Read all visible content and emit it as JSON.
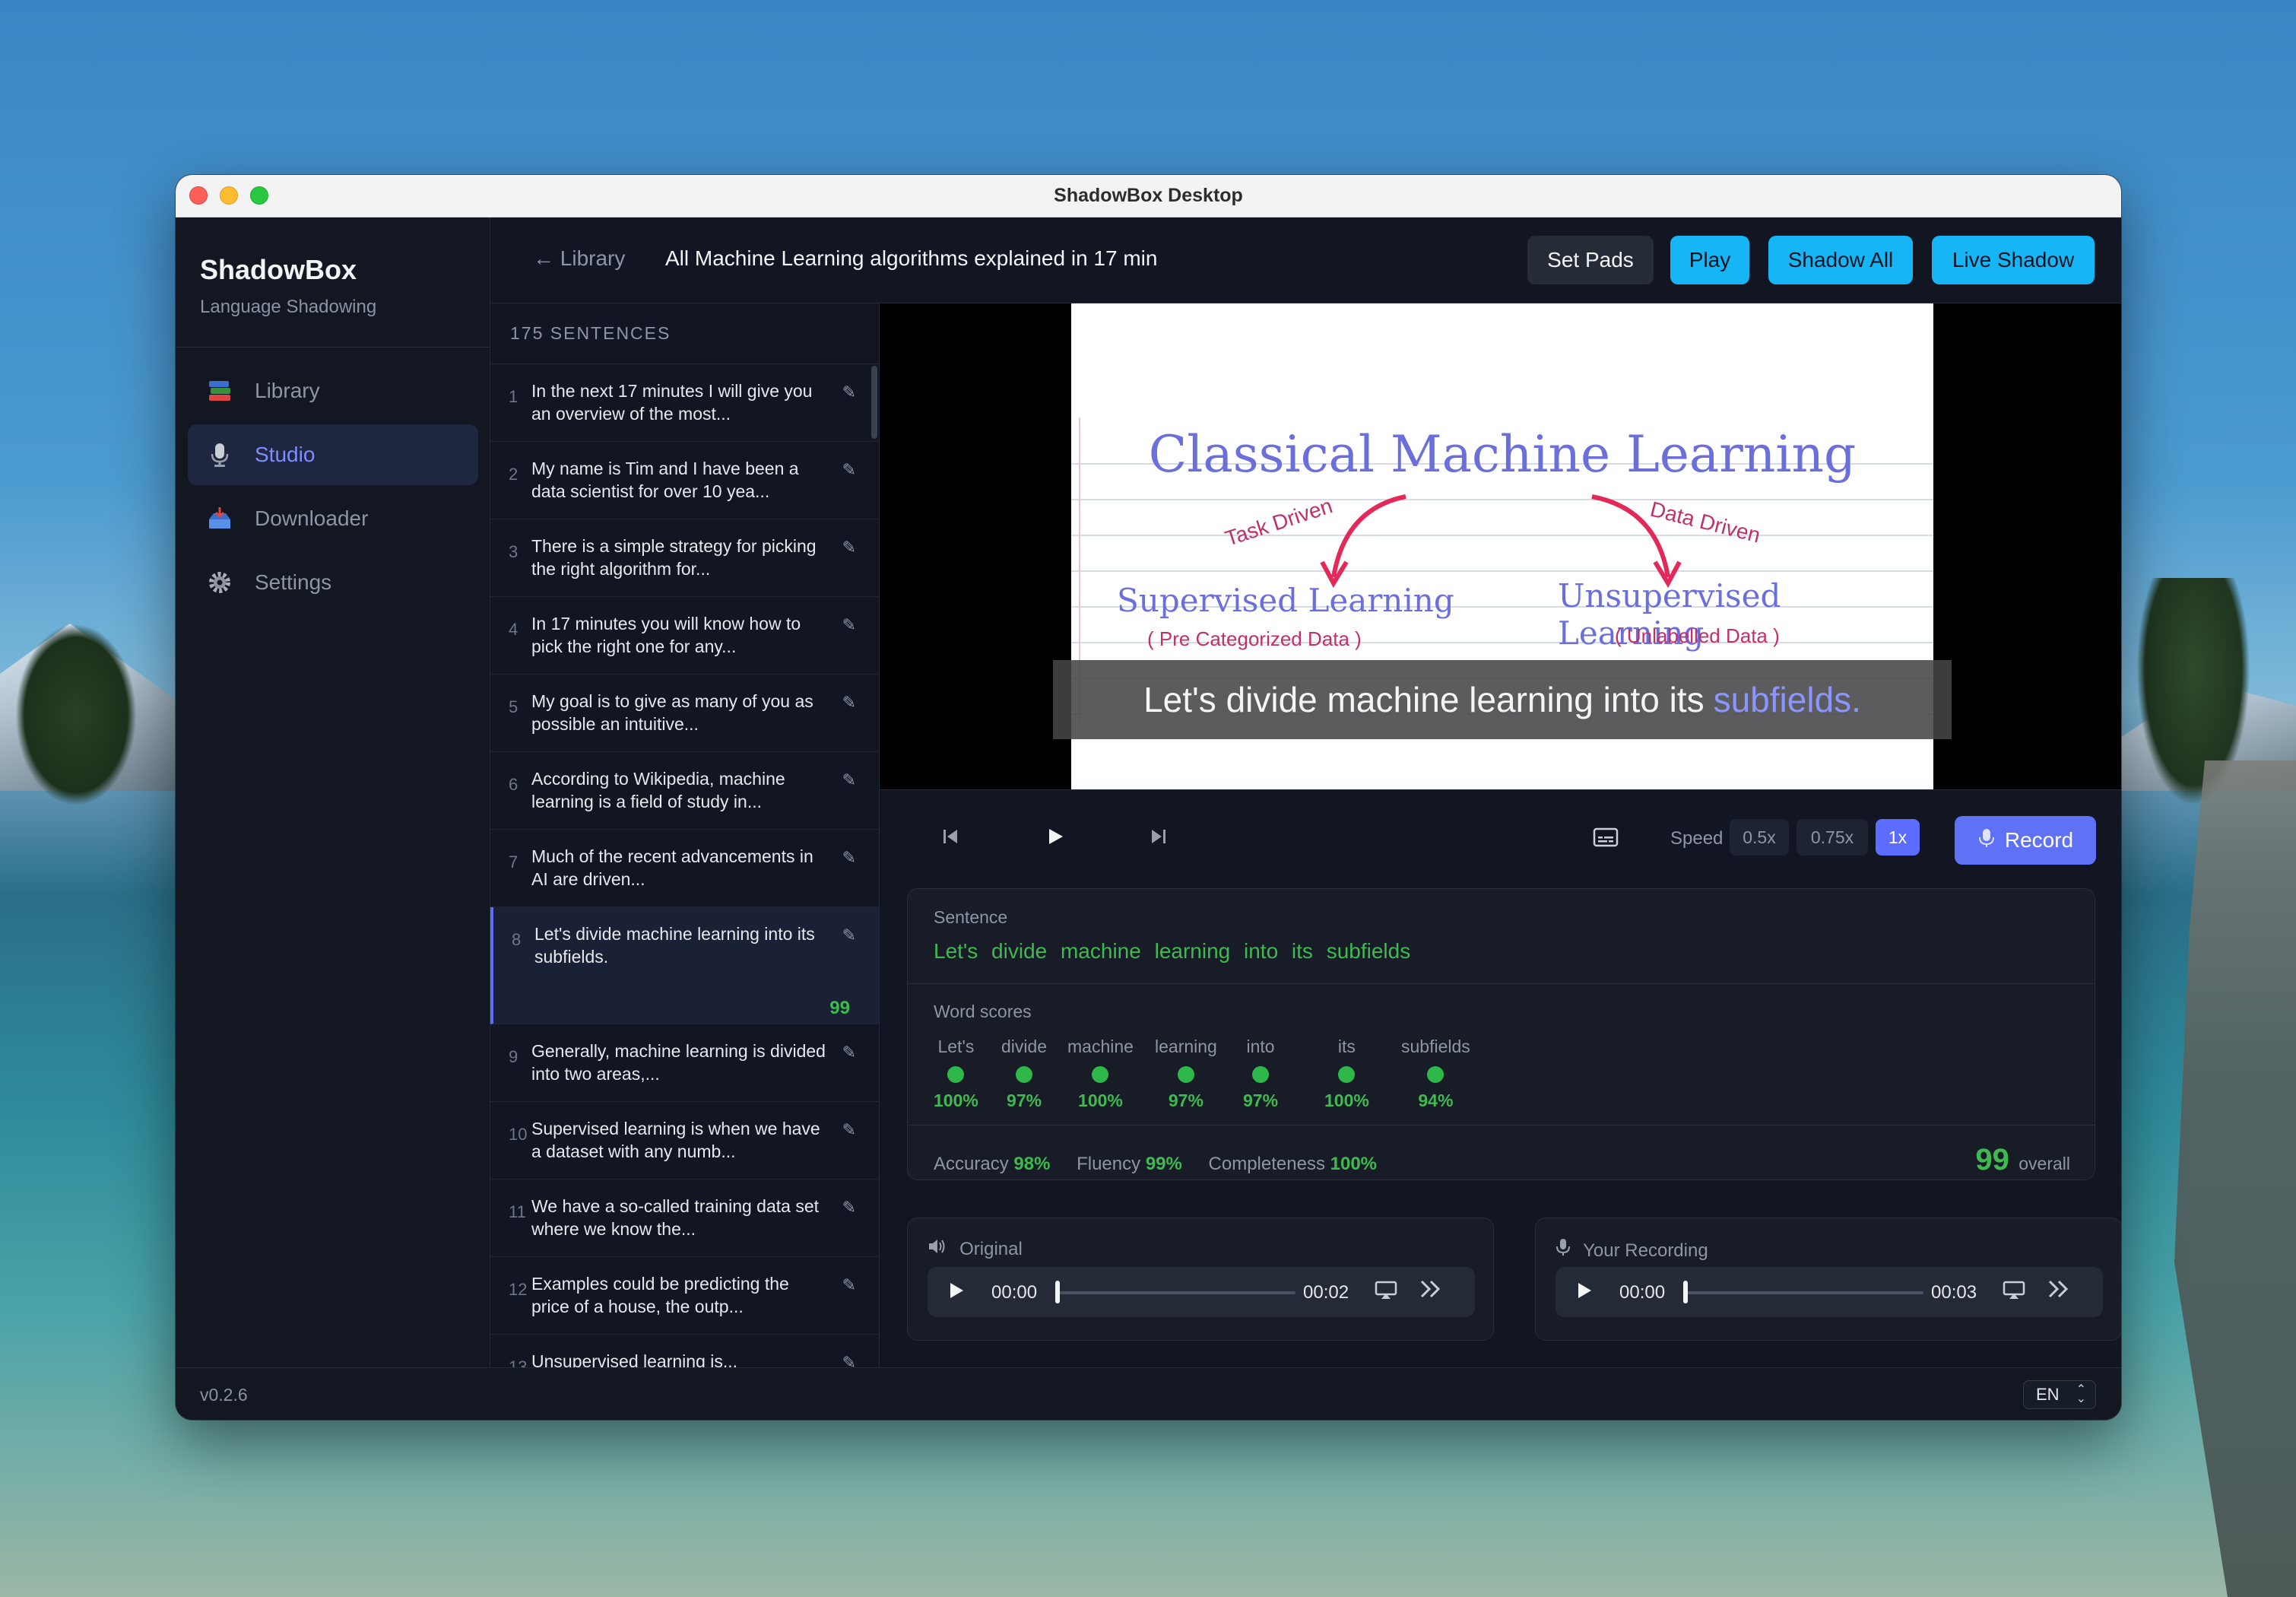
{
  "window": {
    "title": "ShadowBox Desktop"
  },
  "sidebar": {
    "brand": "ShadowBox",
    "subtitle": "Language Shadowing",
    "items": [
      {
        "label": "Library",
        "icon": "books-icon"
      },
      {
        "label": "Studio",
        "icon": "microphone-icon",
        "active": true
      },
      {
        "label": "Downloader",
        "icon": "inbox-tray-icon"
      },
      {
        "label": "Settings",
        "icon": "gear-icon"
      }
    ],
    "version": "v0.2.6"
  },
  "footer": {
    "language": "EN"
  },
  "header": {
    "back_label": "← Library",
    "title": "All Machine Learning algorithms explained in 17 min",
    "buttons": {
      "set_pads": "Set Pads",
      "play": "Play",
      "shadow_all": "Shadow All",
      "live_shadow": "Live Shadow"
    }
  },
  "sentences": {
    "count_label": "175 SENTENCES",
    "items": [
      {
        "num": "1",
        "text": "In the next 17 minutes I will give you an overview of the most..."
      },
      {
        "num": "2",
        "text": "My name is Tim and I have been a data scientist for over 10 yea..."
      },
      {
        "num": "3",
        "text": "There is a simple strategy for picking the right algorithm for..."
      },
      {
        "num": "4",
        "text": "In 17 minutes you will know how to pick the right one for any..."
      },
      {
        "num": "5",
        "text": "My goal is to give as many of you as possible an intuitive..."
      },
      {
        "num": "6",
        "text": "According to Wikipedia, machine learning is a field of study in..."
      },
      {
        "num": "7",
        "text": "Much of the recent advancements in AI are driven..."
      },
      {
        "num": "8",
        "text": "Let's divide machine learning into its subfields.",
        "score": "99",
        "active": true
      },
      {
        "num": "9",
        "text": "Generally, machine learning is divided into two areas,..."
      },
      {
        "num": "10",
        "text": "Supervised learning is when we have a dataset with any numb..."
      },
      {
        "num": "11",
        "text": "We have a so-called training data set where we know the..."
      },
      {
        "num": "12",
        "text": "Examples could be predicting the price of a house, the outp..."
      },
      {
        "num": "13",
        "text": "Unsupervised learning is..."
      }
    ]
  },
  "video": {
    "slide": {
      "title": "Classical Machine Learning",
      "left_arrow_label": "Task Driven",
      "right_arrow_label": "Data Driven",
      "left_heading": "Supervised Learning",
      "left_sub": "( Pre Categorized Data )",
      "right_heading": "Unsupervised Learning",
      "right_sub": "( Unlabelled Data )"
    },
    "subtitle_main": "Let's divide machine learning into its",
    "subtitle_highlight": "subfields."
  },
  "controls": {
    "speed_label": "Speed",
    "speeds": [
      "0.5x",
      "0.75x",
      "1x"
    ],
    "active_speed": "1x",
    "record_label": "Record"
  },
  "scores": {
    "sentence_label": "Sentence",
    "sentence": "Let's divide machine learning into its subfields",
    "word_scores_label": "Word scores",
    "words": [
      {
        "word": "Let's",
        "score": "100%"
      },
      {
        "word": "divide",
        "score": "97%"
      },
      {
        "word": "machine",
        "score": "100%"
      },
      {
        "word": "learning",
        "score": "97%"
      },
      {
        "word": "into",
        "score": "97%"
      },
      {
        "word": "its",
        "score": "100%"
      },
      {
        "word": "subfields",
        "score": "94%"
      }
    ],
    "accuracy_label": "Accuracy",
    "accuracy": "98%",
    "fluency_label": "Fluency",
    "fluency": "99%",
    "completeness_label": "Completeness",
    "completeness": "100%",
    "overall": "99",
    "overall_label": "overall",
    "status_color": "#3fb950"
  },
  "audio": {
    "original": {
      "title": "Original",
      "current": "00:00",
      "duration": "00:02",
      "progress": 0
    },
    "recording": {
      "title": "Your Recording",
      "current": "00:00",
      "duration": "00:03",
      "progress": 0
    }
  }
}
